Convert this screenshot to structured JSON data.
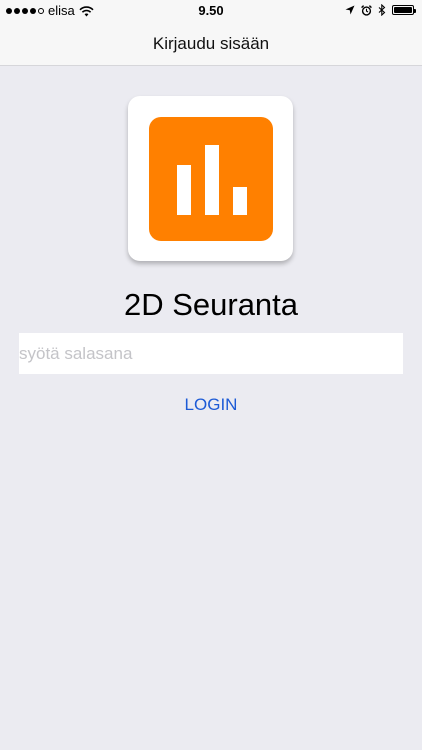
{
  "status_bar": {
    "carrier": "elisa",
    "time": "9.50",
    "signal_bars_filled": 4,
    "signal_bars_total": 5,
    "battery_level": 1.0
  },
  "nav": {
    "title": "Kirjaudu sisään"
  },
  "app": {
    "icon_name": "bar-chart-icon",
    "icon_color": "#ff8000",
    "name": "2D Seuranta"
  },
  "login": {
    "password_placeholder": "syötä salasana",
    "password_value": "",
    "button_label": "LOGIN",
    "button_color": "#1d5bd6"
  }
}
